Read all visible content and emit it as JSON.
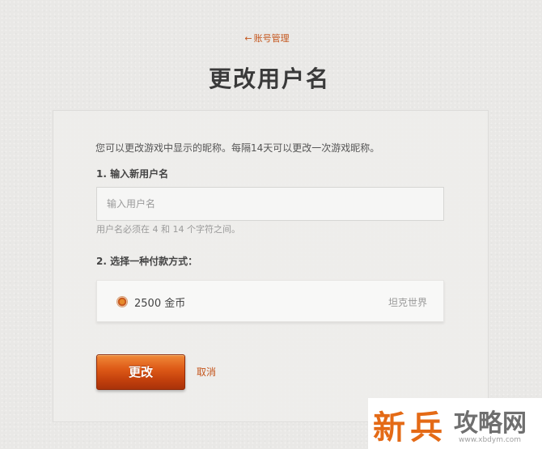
{
  "nav": {
    "back_arrow": "←",
    "back_label": "账号管理"
  },
  "page": {
    "title": "更改用户名"
  },
  "form": {
    "description": "您可以更改游戏中显示的昵称。每隔14天可以更改一次游戏昵称。",
    "step1_label": "1. 输入新用户名",
    "username_value": "",
    "username_placeholder": "输入用户名",
    "username_hint": "用户名必须在 4 和 14 个字符之间。",
    "step2_label": "2. 选择一种付款方式：",
    "payment": {
      "price": "2500 金币",
      "game": "坦克世界",
      "icon": "gold-coin-icon"
    },
    "submit_label": "更改",
    "cancel_label": "取消"
  },
  "watermark": {
    "char1": "新",
    "char2": "兵",
    "text": "攻略网",
    "url": "www.xbdym.com"
  },
  "colors": {
    "accent": "#c4551b",
    "button": "#de5a17",
    "title": "#3a3a3a"
  }
}
